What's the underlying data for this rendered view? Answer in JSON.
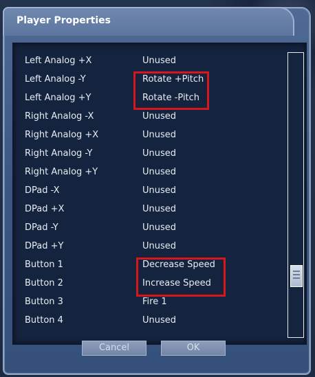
{
  "window": {
    "title": "Player Properties"
  },
  "bindings": [
    {
      "key": "Left Analog +X",
      "value": "Unused"
    },
    {
      "key": "Left Analog -Y",
      "value": "Rotate +Pitch"
    },
    {
      "key": "Left Analog +Y",
      "value": "Rotate -Pitch"
    },
    {
      "key": "Right Analog -X",
      "value": "Unused"
    },
    {
      "key": "Right Analog +X",
      "value": "Unused"
    },
    {
      "key": "Right Analog -Y",
      "value": "Unused"
    },
    {
      "key": "Right Analog +Y",
      "value": "Unused"
    },
    {
      "key": "DPad -X",
      "value": "Unused"
    },
    {
      "key": "DPad +X",
      "value": "Unused"
    },
    {
      "key": "DPad -Y",
      "value": "Unused"
    },
    {
      "key": "DPad +Y",
      "value": "Unused"
    },
    {
      "key": "Button 1",
      "value": "Decrease Speed"
    },
    {
      "key": "Button 2",
      "value": "Increase Speed"
    },
    {
      "key": "Button 3",
      "value": "Fire 1"
    },
    {
      "key": "Button 4",
      "value": "Unused"
    }
  ],
  "buttons": {
    "cancel": "Cancel",
    "ok": "OK"
  },
  "colors": {
    "highlight": "#d8171c",
    "panel": "#14233e",
    "window": "#4f6a95"
  }
}
